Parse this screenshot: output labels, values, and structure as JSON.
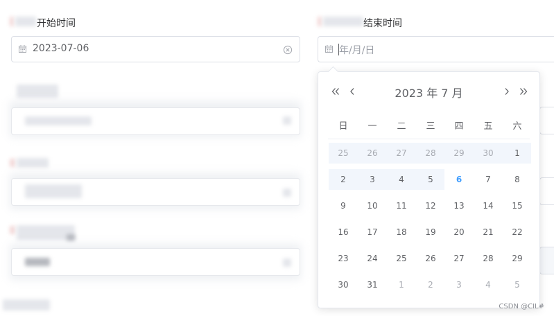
{
  "form": {
    "start_label": "开始时间",
    "start_value": "2023-07-06",
    "end_label": "结束时间",
    "end_placeholder": "年/月/日"
  },
  "picker": {
    "header": "2023 年  7 月",
    "weekdays": [
      "日",
      "一",
      "二",
      "三",
      "四",
      "五",
      "六"
    ],
    "weeks": [
      [
        "25",
        "26",
        "27",
        "28",
        "29",
        "30",
        "1"
      ],
      [
        "2",
        "3",
        "4",
        "5",
        "6",
        "7",
        "8"
      ],
      [
        "9",
        "10",
        "11",
        "12",
        "13",
        "14",
        "15"
      ],
      [
        "16",
        "17",
        "18",
        "19",
        "20",
        "21",
        "22"
      ],
      [
        "23",
        "24",
        "25",
        "26",
        "27",
        "28",
        "29"
      ],
      [
        "30",
        "31",
        "1",
        "2",
        "3",
        "4",
        "5"
      ]
    ],
    "today": "6"
  },
  "colors": {
    "accent": "#409eff",
    "range_highlight": "#f2f6fc"
  },
  "icons": {
    "calendar": "calendar-icon",
    "clear": "circle-close-icon",
    "prev_year": "double-chevron-left-icon",
    "prev_month": "chevron-left-icon",
    "next_month": "chevron-right-icon",
    "next_year": "double-chevron-right-icon"
  },
  "watermark": "CSDN @CIL#"
}
